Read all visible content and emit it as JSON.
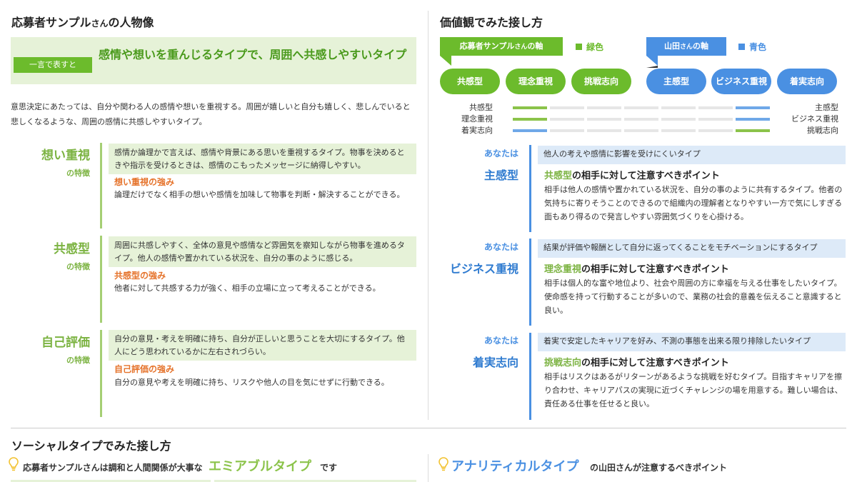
{
  "left": {
    "title_name": "応募者サンプル",
    "title_san": "さん",
    "title_rest": "の人物像",
    "summary_tag": "一言で表すと",
    "summary_text": "感情や想いを重んじるタイプで、周囲へ共感しやすいタイプ",
    "description": "意思決定にあたっては、自分や関わる人の感情や想いを重視する。周囲が嬉しいと自分も嬉しく、悲しんでいると悲しくなるような、周囲の感情に共感しやすいタイプ。",
    "traits": [
      {
        "name": "想い重視",
        "sub": "の特徴",
        "box": "感情か論理かで言えば、感情や背景にある思いを重視するタイプ。物事を決めるときや指示を受けるときは、感情のこもったメッセージに納得しやすい。",
        "strength_title": "想い重視の強み",
        "strength_text": "論理だけでなく相手の想いや感情を加味して物事を判断・解決することができる。"
      },
      {
        "name": "共感型",
        "sub": "の特徴",
        "box": "周囲に共感しやすく、全体の意見や感情など雰囲気を察知しながら物事を進めるタイプ。他人の感情や置かれている状況を、自分の事のように感じる。",
        "strength_title": "共感型の強み",
        "strength_text": "他者に対して共感する力が強く、相手の立場に立って考えることができる。"
      },
      {
        "name": "自己評価",
        "sub": "の特徴",
        "box": "自分の意見・考えを明確に持ち、自分が正しいと思うことを大切にするタイプ。他人にどう思われているかに左右されづらい。",
        "strength_title": "自己評価の強み",
        "strength_text": "自分の意見や考えを明確に持ち、リスクや他人の目を気にせずに行動できる。"
      }
    ]
  },
  "right": {
    "title": "価値観でみた接し方",
    "axis_applicant_name": "応募者サンプル",
    "axis_applicant_san": "さん",
    "axis_applicant_suffix": "の軸",
    "legend_applicant": "緑色",
    "axis_yamada_name": "山田",
    "axis_yamada_san": "さん",
    "axis_yamada_suffix": "の軸",
    "legend_yamada": "青色",
    "pills_applicant": [
      "共感型",
      "理念重視",
      "挑戦志向"
    ],
    "pills_yamada": [
      "主感型",
      "ビジネス重視",
      "着実志向"
    ],
    "bars": [
      {
        "left": "共感型",
        "right": "主感型",
        "green_segment": 0,
        "blue_segment": 6
      },
      {
        "left": "理念重視",
        "right": "ビジネス重視",
        "green_segment": 0,
        "blue_segment": 6
      },
      {
        "left": "着実志向",
        "right": "挑戦志向",
        "green_segment": 6,
        "blue_segment": 0
      }
    ],
    "advice": [
      {
        "you_label": "あなたは",
        "type": "主感型",
        "box": "他人の考えや感情に影響を受けにくいタイプ",
        "hl": "共感型",
        "title_rest": "の相手に対して注意すべきポイント",
        "text": "相手は他人の感情や置かれている状況を、自分の事のように共有するタイプ。他者の気持ちに寄りそうことのできるので組織内の理解者となりやすい一方で気にしすぎる面もあり得るので発言しやすい雰囲気づくりを心掛ける。"
      },
      {
        "you_label": "あなたは",
        "type": "ビジネス重視",
        "box": "結果が評価や報酬として自分に返ってくることをモチベーションにするタイプ",
        "hl": "理念重視",
        "title_rest": "の相手に対して注意すべきポイント",
        "text": "相手は個人的な富や地位より、社会や周囲の方に幸福を与える仕事をしたいタイプ。使命感を持って行動することが多いので、業務の社会的意義を伝えること意識すると良い。"
      },
      {
        "you_label": "あなたは",
        "type": "着実志向",
        "box": "着実で安定したキャリアを好み、不測の事態を出来る限り排除したいタイプ",
        "hl": "挑戦志向",
        "title_rest": "の相手に対して注意すべきポイント",
        "text": "相手はリスクはあるがリターンがあるような挑戦を好むタイプ。目指すキャリアを擦り合わせ、キャリアパスの実現に近づくチャレンジの場を用意する。難しい場合は、責任ある仕事を任せると良い。"
      }
    ]
  },
  "bottom": {
    "title": "ソーシャルタイプでみた接し方",
    "left_prefix": "応募者サンプルさんは調和と人間関係が大事な",
    "left_type": "エミアブルタイプ",
    "left_suffix": "です",
    "right_type": "アナリティカルタイプ",
    "right_suffix": "の山田さんが注意するべきポイント"
  },
  "colors": {
    "green": "#6cbb2c",
    "blue": "#4a90e2",
    "light_green": "#e6f2d8",
    "light_blue": "#ddeaf8",
    "orange": "#e5722a"
  },
  "icons": {
    "bulb": "lightbulb-icon"
  }
}
